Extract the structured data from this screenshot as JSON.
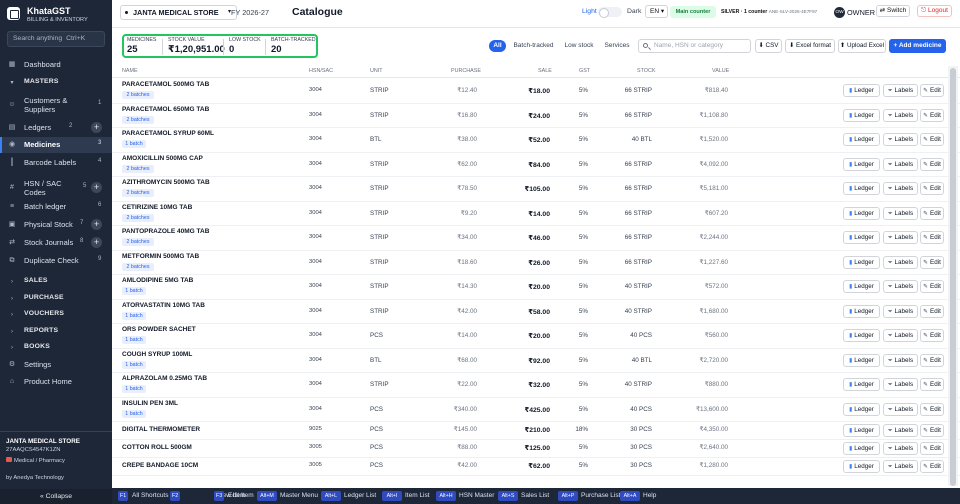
{
  "app": {
    "name": "KhataGST",
    "subtitle": "BILLING & INVENTORY"
  },
  "sidebar": {
    "search_placeholder": "Search anything",
    "search_shortcut": "Ctrl+K",
    "items": [
      {
        "label": "Dashboard",
        "icon": "dashboard-icon"
      },
      {
        "label": "MASTERS",
        "icon": "chevron-down-icon",
        "section": true
      },
      {
        "label": "Customers & Suppliers",
        "count": "1"
      },
      {
        "label": "Ledgers",
        "count": "2",
        "plus": true
      },
      {
        "label": "Medicines",
        "count": "3",
        "active": true
      },
      {
        "label": "Barcode Labels",
        "count": "4"
      },
      {
        "label": "HSN / SAC Codes",
        "count": "5",
        "plus": true
      },
      {
        "label": "Batch ledger",
        "count": "6"
      },
      {
        "label": "Physical Stock",
        "count": "7",
        "plus": true
      },
      {
        "label": "Stock Journals",
        "count": "8",
        "plus": true
      },
      {
        "label": "Duplicate Check",
        "count": "9"
      },
      {
        "label": "SALES",
        "section": true
      },
      {
        "label": "PURCHASE",
        "section": true
      },
      {
        "label": "VOUCHERS",
        "section": true
      },
      {
        "label": "REPORTS",
        "section": true
      },
      {
        "label": "BOOKS",
        "section": true
      },
      {
        "label": "Settings"
      },
      {
        "label": "Product Home"
      }
    ],
    "company": "JANTA MEDICAL STORE",
    "gstin": "27AAQCS4547K1ZN",
    "business_type": "Medical / Pharmacy",
    "by": "by Anedya Technology",
    "collapse": "« Collapse"
  },
  "topbar": {
    "company": "JANTA MEDICAL STORE",
    "fy": "FY 2026-27",
    "title": "Catalogue",
    "theme_light": "Light",
    "theme_dark": "Dark",
    "lang": "EN",
    "counter": "Main counter",
    "license_plan": "SILVER · 1 counter",
    "license_key": "ANE-SLV-2026-4E7F97",
    "avatar": "OW",
    "role": "OWNER",
    "switch": "Switch",
    "logout": "Logout"
  },
  "kpis": [
    {
      "label": "MEDICINES",
      "value": "25"
    },
    {
      "label": "STOCK VALUE",
      "value": "₹1,20,951.00"
    },
    {
      "label": "LOW STOCK",
      "value": "0"
    },
    {
      "label": "BATCH-TRACKED",
      "value": "20"
    }
  ],
  "filters": [
    "All",
    "Batch-tracked",
    "Low stock",
    "Services"
  ],
  "search": {
    "placeholder": "Name, HSN or category"
  },
  "actions": {
    "csv": "CSV",
    "excel_format": "Excel format",
    "upload_excel": "Upload Excel",
    "add": "+ Add medicine"
  },
  "table": {
    "columns": [
      "NAME",
      "HSN/SAC",
      "UNIT",
      "PURCHASE",
      "SALE",
      "GST",
      "STOCK",
      "VALUE"
    ],
    "row_actions": [
      "Ledger",
      "Labels",
      "Edit"
    ],
    "rows": [
      {
        "name": "PARACETAMOL 500MG TAB",
        "batches": "2 batches",
        "hsn": "3004",
        "unit": "STRIP",
        "purchase": "₹12.40",
        "sale": "₹18.00",
        "gst": "5%",
        "stock": "66 STRIP",
        "value": "₹818.40"
      },
      {
        "name": "PARACETAMOL 650MG TAB",
        "batches": "2 batches",
        "hsn": "3004",
        "unit": "STRIP",
        "purchase": "₹16.80",
        "sale": "₹24.00",
        "gst": "5%",
        "stock": "66 STRIP",
        "value": "₹1,108.80"
      },
      {
        "name": "PARACETAMOL SYRUP 60ML",
        "batches": "1 batch",
        "hsn": "3004",
        "unit": "BTL",
        "purchase": "₹38.00",
        "sale": "₹52.00",
        "gst": "5%",
        "stock": "40 BTL",
        "value": "₹1,520.00"
      },
      {
        "name": "AMOXICILLIN 500MG CAP",
        "batches": "2 batches",
        "hsn": "3004",
        "unit": "STRIP",
        "purchase": "₹62.00",
        "sale": "₹84.00",
        "gst": "5%",
        "stock": "66 STRIP",
        "value": "₹4,092.00"
      },
      {
        "name": "AZITHROMYCIN 500MG TAB",
        "batches": "2 batches",
        "hsn": "3004",
        "unit": "STRIP",
        "purchase": "₹78.50",
        "sale": "₹105.00",
        "gst": "5%",
        "stock": "66 STRIP",
        "value": "₹5,181.00"
      },
      {
        "name": "CETIRIZINE 10MG TAB",
        "batches": "2 batches",
        "hsn": "3004",
        "unit": "STRIP",
        "purchase": "₹9.20",
        "sale": "₹14.00",
        "gst": "5%",
        "stock": "66 STRIP",
        "value": "₹607.20"
      },
      {
        "name": "PANTOPRAZOLE 40MG TAB",
        "batches": "2 batches",
        "hsn": "3004",
        "unit": "STRIP",
        "purchase": "₹34.00",
        "sale": "₹46.00",
        "gst": "5%",
        "stock": "66 STRIP",
        "value": "₹2,244.00"
      },
      {
        "name": "METFORMIN 500MG TAB",
        "batches": "2 batches",
        "hsn": "3004",
        "unit": "STRIP",
        "purchase": "₹18.60",
        "sale": "₹26.00",
        "gst": "5%",
        "stock": "66 STRIP",
        "value": "₹1,227.60"
      },
      {
        "name": "AMLODIPINE 5MG TAB",
        "batches": "1 batch",
        "hsn": "3004",
        "unit": "STRIP",
        "purchase": "₹14.30",
        "sale": "₹20.00",
        "gst": "5%",
        "stock": "40 STRIP",
        "value": "₹572.00"
      },
      {
        "name": "ATORVASTATIN 10MG TAB",
        "batches": "1 batch",
        "hsn": "3004",
        "unit": "STRIP",
        "purchase": "₹42.00",
        "sale": "₹58.00",
        "gst": "5%",
        "stock": "40 STRIP",
        "value": "₹1,680.00"
      },
      {
        "name": "ORS POWDER SACHET",
        "batches": "1 batch",
        "hsn": "3004",
        "unit": "PCS",
        "purchase": "₹14.00",
        "sale": "₹20.00",
        "gst": "5%",
        "stock": "40 PCS",
        "value": "₹560.00"
      },
      {
        "name": "COUGH SYRUP 100ML",
        "batches": "1 batch",
        "hsn": "3004",
        "unit": "BTL",
        "purchase": "₹68.00",
        "sale": "₹92.00",
        "gst": "5%",
        "stock": "40 BTL",
        "value": "₹2,720.00"
      },
      {
        "name": "ALPRAZOLAM 0.25MG TAB",
        "batches": "1 batch",
        "hsn": "3004",
        "unit": "STRIP",
        "purchase": "₹22.00",
        "sale": "₹32.00",
        "gst": "5%",
        "stock": "40 STRIP",
        "value": "₹880.00"
      },
      {
        "name": "INSULIN PEN 3ML",
        "batches": "1 batch",
        "hsn": "3004",
        "unit": "PCS",
        "purchase": "₹340.00",
        "sale": "₹425.00",
        "gst": "5%",
        "stock": "40 PCS",
        "value": "₹13,600.00"
      },
      {
        "name": "DIGITAL THERMOMETER",
        "batches": "",
        "hsn": "9025",
        "unit": "PCS",
        "purchase": "₹145.00",
        "sale": "₹210.00",
        "gst": "18%",
        "stock": "30 PCS",
        "value": "₹4,350.00"
      },
      {
        "name": "COTTON ROLL 500GM",
        "batches": "",
        "hsn": "3005",
        "unit": "PCS",
        "purchase": "₹88.00",
        "sale": "₹125.00",
        "gst": "5%",
        "stock": "30 PCS",
        "value": "₹2,640.00"
      },
      {
        "name": "CREPE BANDAGE 10CM",
        "batches": "",
        "hsn": "3005",
        "unit": "PCS",
        "purchase": "₹42.00",
        "sale": "₹62.00",
        "gst": "5%",
        "stock": "30 PCS",
        "value": "₹1,280.00"
      }
    ]
  },
  "footer": [
    {
      "key": "F1",
      "label": "All Shortcuts"
    },
    {
      "key": "F2",
      "label": "New Item"
    },
    {
      "key": "F3",
      "label": "Edit Item"
    },
    {
      "key": "Alt+M",
      "label": "Master Menu"
    },
    {
      "key": "Alt+L",
      "label": "Ledger List"
    },
    {
      "key": "Alt+I",
      "label": "Item List"
    },
    {
      "key": "Alt+H",
      "label": "HSN Master"
    },
    {
      "key": "Alt+S",
      "label": "Sales List"
    },
    {
      "key": "Alt+P",
      "label": "Purchase List"
    },
    {
      "key": "Alt+A",
      "label": "Help"
    }
  ],
  "colors": {
    "accent": "#2563eb",
    "sidebar_bg": "#1e2738",
    "highlight": "#22c55e",
    "logout": "#dc2626"
  }
}
